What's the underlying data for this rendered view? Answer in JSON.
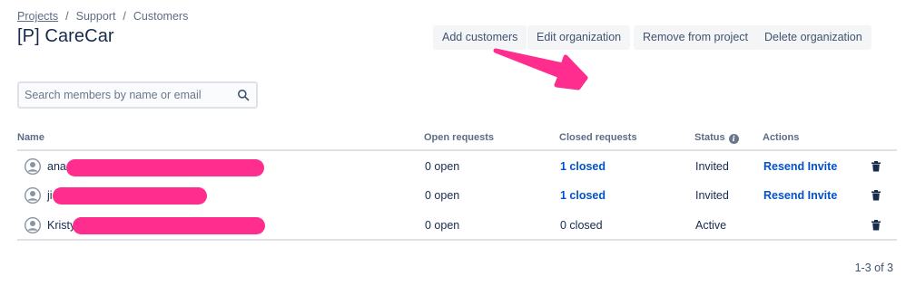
{
  "breadcrumb": {
    "projects": "Projects",
    "support": "Support",
    "customers": "Customers",
    "sep": "/"
  },
  "page_title": "[P] CareCar",
  "toolbar": {
    "add_customers": "Add customers",
    "edit_organization": "Edit organization",
    "remove_from_project": "Remove from project",
    "delete_organization": "Delete organization"
  },
  "search": {
    "placeholder": "Search members by name or email",
    "value": ""
  },
  "table": {
    "headers": {
      "name": "Name",
      "open": "Open requests",
      "closed": "Closed requests",
      "status": "Status",
      "actions": "Actions"
    },
    "rows": [
      {
        "name": "ana",
        "open": "0 open",
        "closed": "1 closed",
        "status": "Invited",
        "action": "Resend Invite"
      },
      {
        "name": "ji",
        "open": "0 open",
        "closed": "1 closed",
        "status": "Invited",
        "action": "Resend Invite"
      },
      {
        "name": "Kristy",
        "open": "0 open",
        "closed": "0 closed",
        "status": "Active",
        "action": ""
      }
    ]
  },
  "pagination": "1-3 of 3",
  "colors": {
    "link": "#0052CC",
    "annotation": "#FF2D8E",
    "text": "#172B4D",
    "muted": "#5E6C84",
    "button_bg": "#F4F5F7"
  },
  "icons": {
    "search": "search-icon",
    "avatar": "user-avatar-icon",
    "delete": "trash-icon",
    "status_info": "info-icon"
  }
}
